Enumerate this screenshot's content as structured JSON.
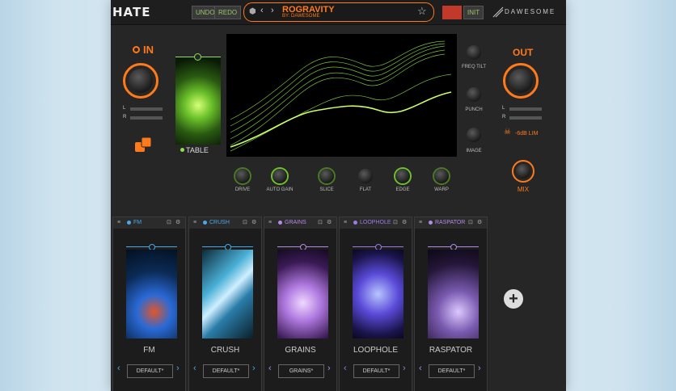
{
  "app": {
    "logo": "HATE",
    "brand": "DAWESOME"
  },
  "toolbar": {
    "undo": "UNDO",
    "redo": "REDO",
    "init": "INIT",
    "red_btn": ""
  },
  "preset": {
    "name": "ROGRAVITY",
    "author": "BY: DAWESOME"
  },
  "in_section": {
    "label": "IN",
    "meter_l": "L",
    "meter_r": "R"
  },
  "out_section": {
    "label": "OUT",
    "meter_l": "L",
    "meter_r": "R",
    "limiter": "-6dB LIM",
    "mix": "MIX"
  },
  "table": {
    "label": "TABLE"
  },
  "right_knobs": [
    "FREQ TILT",
    "PUNCH",
    "IMAGE"
  ],
  "bottom_knobs": [
    "DRIVE",
    "AUTO GAIN",
    "SLICE",
    "FLAT",
    "EDGE",
    "WARP"
  ],
  "slots": [
    {
      "tab": "FM",
      "title": "FM",
      "preset": "DEFAULT*",
      "color": "#4aa9e8"
    },
    {
      "tab": "CRUSH",
      "title": "CRUSH",
      "preset": "DEFAULT*",
      "color": "#4aa9e8"
    },
    {
      "tab": "GRAINS",
      "title": "GRAINS",
      "preset": "GRAINS*",
      "color": "#b48be8"
    },
    {
      "tab": "LOOPHOLE",
      "title": "LOOPHOLE",
      "preset": "DEFAULT*",
      "color": "#9a7be8"
    },
    {
      "tab": "RASPATOR",
      "title": "RASPATOR",
      "preset": "DEFAULT*",
      "color": "#b48be8"
    }
  ],
  "colors": {
    "accent": "#ff7a1a",
    "green": "#8fe04a",
    "blue": "#4aa9e8",
    "purple": "#9a7be8"
  }
}
